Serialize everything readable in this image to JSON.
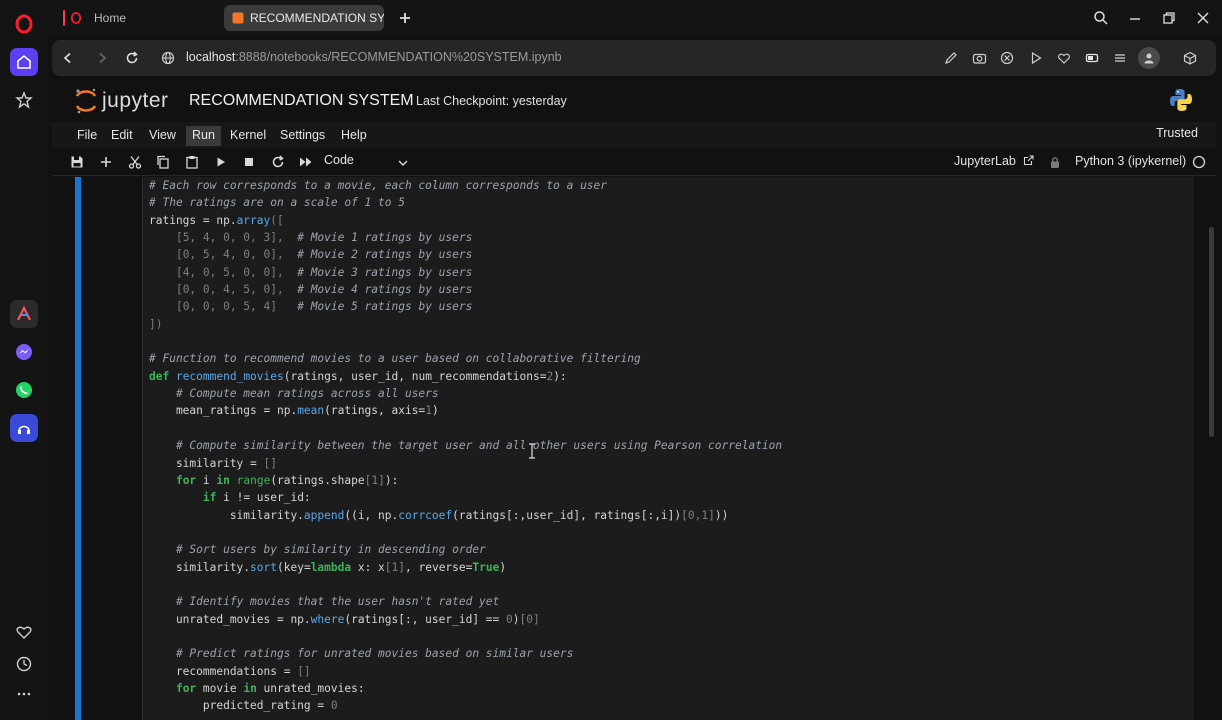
{
  "browser": {
    "tabs": [
      {
        "label": "Home"
      },
      {
        "label": "RECOMMENDATION SYST"
      }
    ],
    "url": {
      "host": "localhost",
      "path": ":8888/notebooks/RECOMMENDATION%20SYSTEM.ipynb"
    }
  },
  "jupyter": {
    "logo_text": "jupyter",
    "notebook_title": "RECOMMENDATION SYSTEM",
    "checkpoint": "Last Checkpoint: yesterday",
    "menu": [
      "File",
      "Edit",
      "View",
      "Run",
      "Kernel",
      "Settings",
      "Help"
    ],
    "active_menu": "Run",
    "trusted": "Trusted",
    "toolbar": {
      "cell_type": "Code",
      "jupyterlab_link": "JupyterLab",
      "kernel": "Python 3 (ipykernel)"
    }
  },
  "code_lines": [
    [
      [
        "cm",
        "# Each row corresponds to a movie, each column corresponds to a user"
      ]
    ],
    [
      [
        "cm",
        "# The ratings are on a scale of 1 to 5"
      ]
    ],
    [
      [
        "",
        "ratings = np."
      ],
      [
        "fn",
        "array"
      ],
      [
        "num",
        "(["
      ]
    ],
    [
      [
        "",
        "    "
      ],
      [
        "num",
        "[5, 4, 0, 0, 3],"
      ],
      [
        "",
        "  "
      ],
      [
        "cm",
        "# Movie 1 ratings by users"
      ]
    ],
    [
      [
        "",
        "    "
      ],
      [
        "num",
        "[0, 5, 4, 0, 0],"
      ],
      [
        "",
        "  "
      ],
      [
        "cm",
        "# Movie 2 ratings by users"
      ]
    ],
    [
      [
        "",
        "    "
      ],
      [
        "num",
        "[4, 0, 5, 0, 0],"
      ],
      [
        "",
        "  "
      ],
      [
        "cm",
        "# Movie 3 ratings by users"
      ]
    ],
    [
      [
        "",
        "    "
      ],
      [
        "num",
        "[0, 0, 4, 5, 0],"
      ],
      [
        "",
        "  "
      ],
      [
        "cm",
        "# Movie 4 ratings by users"
      ]
    ],
    [
      [
        "",
        "    "
      ],
      [
        "num",
        "[0, 0, 0, 5, 4]"
      ],
      [
        "",
        "   "
      ],
      [
        "cm",
        "# Movie 5 ratings by users"
      ]
    ],
    [
      [
        "num",
        "])"
      ]
    ],
    [
      [
        "",
        ""
      ]
    ],
    [
      [
        "cm",
        "# Function to recommend movies to a user based on collaborative filtering"
      ]
    ],
    [
      [
        "kw",
        "def"
      ],
      [
        "",
        " "
      ],
      [
        "fn",
        "recommend_movies"
      ],
      [
        "",
        "(ratings, user_id, num_recommendations="
      ],
      [
        "num",
        "2"
      ],
      [
        "",
        "):"
      ]
    ],
    [
      [
        "",
        "    "
      ],
      [
        "cm",
        "# Compute mean ratings across all users"
      ]
    ],
    [
      [
        "",
        "    mean_ratings = np."
      ],
      [
        "fn",
        "mean"
      ],
      [
        "",
        "(ratings, axis="
      ],
      [
        "num",
        "1"
      ],
      [
        "",
        ")"
      ]
    ],
    [
      [
        "",
        ""
      ]
    ],
    [
      [
        "",
        "    "
      ],
      [
        "cm",
        "# Compute similarity between the target user and all other users using Pearson correlation"
      ]
    ],
    [
      [
        "",
        "    similarity = "
      ],
      [
        "num",
        "[]"
      ]
    ],
    [
      [
        "",
        "    "
      ],
      [
        "kw",
        "for"
      ],
      [
        "",
        " i "
      ],
      [
        "kw",
        "in"
      ],
      [
        "",
        " "
      ],
      [
        "bi",
        "range"
      ],
      [
        "",
        "(ratings.shape"
      ],
      [
        "num",
        "[1]"
      ],
      [
        "",
        "):"
      ]
    ],
    [
      [
        "",
        "        "
      ],
      [
        "kw",
        "if"
      ],
      [
        "",
        " i != user_id:"
      ]
    ],
    [
      [
        "",
        "            similarity."
      ],
      [
        "fn",
        "append"
      ],
      [
        "",
        "((i, np."
      ],
      [
        "fn",
        "corrcoef"
      ],
      [
        "",
        "(ratings[:,user_id], ratings[:,i])"
      ],
      [
        "num",
        "[0,1]"
      ],
      [
        "",
        "))"
      ]
    ],
    [
      [
        "",
        ""
      ]
    ],
    [
      [
        "",
        "    "
      ],
      [
        "cm",
        "# Sort users by similarity in descending order"
      ]
    ],
    [
      [
        "",
        "    similarity."
      ],
      [
        "fn",
        "sort"
      ],
      [
        "",
        "(key="
      ],
      [
        "kw",
        "lambda"
      ],
      [
        "",
        " x: x"
      ],
      [
        "num",
        "[1]"
      ],
      [
        "",
        ", reverse="
      ],
      [
        "kw",
        "True"
      ],
      [
        "",
        ")"
      ]
    ],
    [
      [
        "",
        ""
      ]
    ],
    [
      [
        "",
        "    "
      ],
      [
        "cm",
        "# Identify movies that the user hasn't rated yet"
      ]
    ],
    [
      [
        "",
        "    unrated_movies = np."
      ],
      [
        "fn",
        "where"
      ],
      [
        "",
        "(ratings[:, user_id] == "
      ],
      [
        "num",
        "0"
      ],
      [
        "",
        ")"
      ],
      [
        "num",
        "[0]"
      ]
    ],
    [
      [
        "",
        ""
      ]
    ],
    [
      [
        "",
        "    "
      ],
      [
        "cm",
        "# Predict ratings for unrated movies based on similar users"
      ]
    ],
    [
      [
        "",
        "    recommendations = "
      ],
      [
        "num",
        "[]"
      ]
    ],
    [
      [
        "",
        "    "
      ],
      [
        "kw",
        "for"
      ],
      [
        "",
        " movie "
      ],
      [
        "kw",
        "in"
      ],
      [
        "",
        " unrated_movies:"
      ]
    ],
    [
      [
        "",
        "        predicted_rating = "
      ],
      [
        "num",
        "0"
      ]
    ]
  ],
  "colors": {
    "accent": "#1976d2",
    "opera_red": "#ff1b2d",
    "keyword": "#3bb55a",
    "function": "#5aa8e8",
    "comment": "#9aa3ad"
  }
}
